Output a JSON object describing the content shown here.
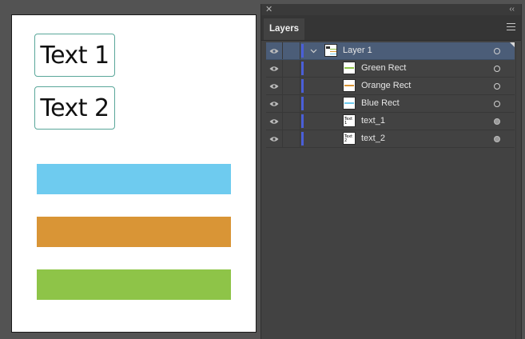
{
  "artboard": {
    "text_frames": [
      "Text 1",
      "Text 2"
    ],
    "rects": [
      {
        "name": "Blue Rect",
        "color": "#6ecbef"
      },
      {
        "name": "Orange Rect",
        "color": "#d99536"
      },
      {
        "name": "Green Rect",
        "color": "#8ec448"
      }
    ]
  },
  "panel": {
    "close_glyph": "✕",
    "collapse_glyph": "‹‹",
    "tab_label": "Layers",
    "layer_color": "#4a5fd8",
    "layers": [
      {
        "label": "Layer 1",
        "type": "layer",
        "selected": true
      },
      {
        "label": "Green Rect",
        "type": "rect",
        "swatch": "#8ec448"
      },
      {
        "label": "Orange Rect",
        "type": "rect",
        "swatch": "#d99536"
      },
      {
        "label": "Blue Rect",
        "type": "rect",
        "swatch": "#6ecbef"
      },
      {
        "label": "text_1",
        "type": "text",
        "thumb_text": "Text 1"
      },
      {
        "label": "text_2",
        "type": "text",
        "thumb_text": "Text 2"
      }
    ]
  },
  "icons": {
    "visibility": "eye-icon",
    "expand": "chevron-down-icon",
    "target": "target-circle-icon",
    "menu": "hamburger-menu-icon"
  }
}
